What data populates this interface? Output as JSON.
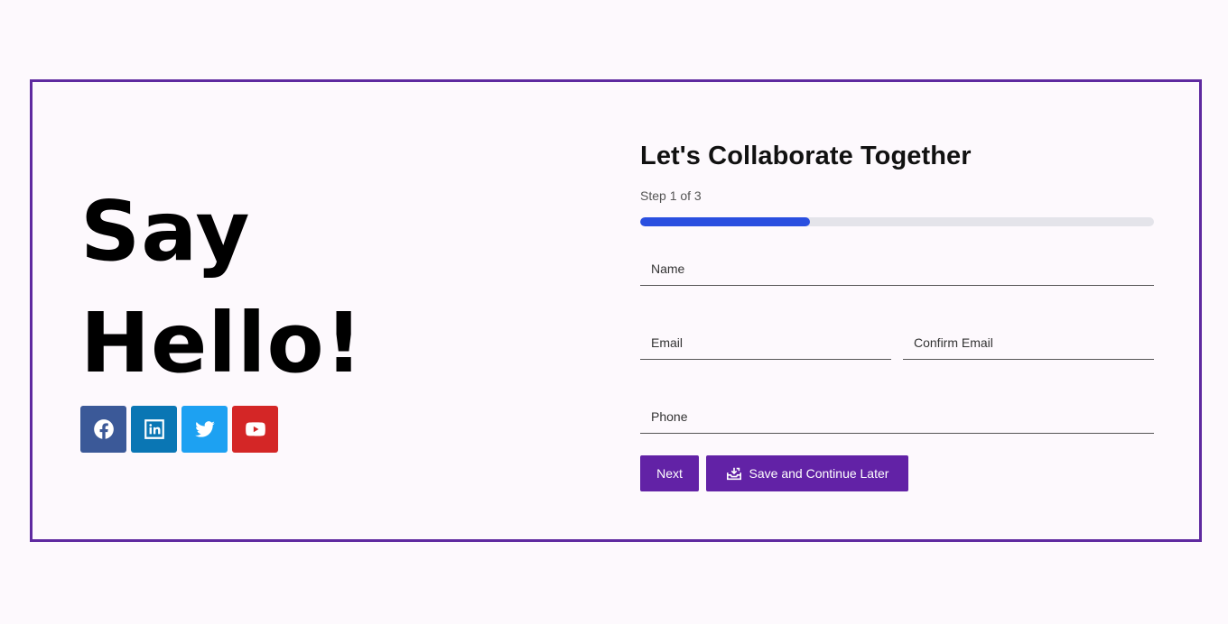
{
  "hero": {
    "line1": "Say",
    "line2": "Hello!"
  },
  "socials": [
    {
      "name": "facebook",
      "icon": "facebook-icon",
      "color": "#3b5998"
    },
    {
      "name": "linkedin",
      "icon": "linkedin-icon",
      "color": "#0a76b4"
    },
    {
      "name": "twitter",
      "icon": "twitter-icon",
      "color": "#1da1f2"
    },
    {
      "name": "youtube",
      "icon": "youtube-icon",
      "color": "#d42626"
    }
  ],
  "form": {
    "title": "Let's Collaborate Together",
    "step_text": "Step 1 of 3",
    "progress": 0.33,
    "fields": {
      "name_placeholder": "Name",
      "email_placeholder": "Email",
      "confirm_email_placeholder": "Confirm Email",
      "phone_placeholder": "Phone"
    },
    "next_label": "Next",
    "save_label": "Save and Continue Later"
  },
  "colors": {
    "accent": "#6222a6",
    "frame_border": "#5f2aa0",
    "progress_fill": "#2a4fe0",
    "progress_track": "#e4e4ea"
  }
}
